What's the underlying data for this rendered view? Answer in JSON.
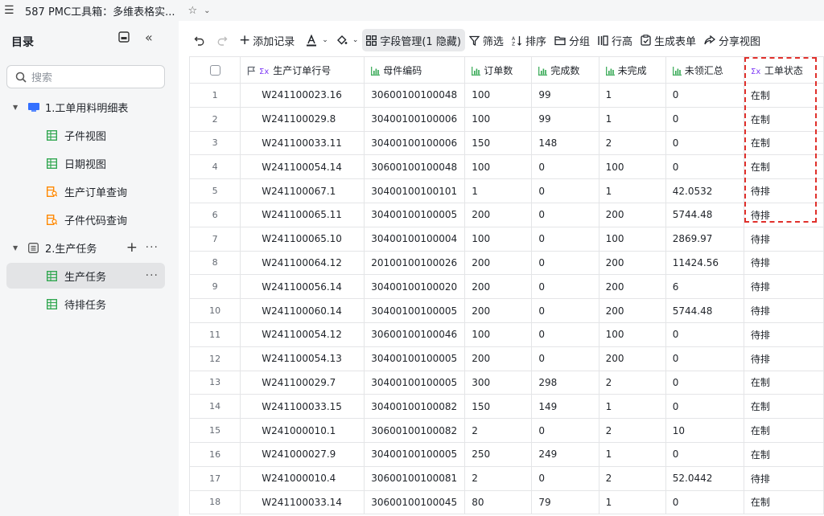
{
  "window": {
    "title": "587 PMC工具箱：多维表格实..."
  },
  "sidebar": {
    "header": "目录",
    "search_placeholder": "搜索",
    "items": [
      {
        "label": "1.工单用料明细表"
      },
      {
        "label": "子件视图"
      },
      {
        "label": "日期视图"
      },
      {
        "label": "生产订单查询"
      },
      {
        "label": "子件代码查询"
      },
      {
        "label": "2.生产任务"
      },
      {
        "label": "生产任务"
      },
      {
        "label": "待排任务"
      }
    ]
  },
  "toolbar": {
    "add_record": "添加记录",
    "field_manage": "字段管理(1 隐藏)",
    "filter": "筛选",
    "sort": "排序",
    "group": "分组",
    "row_height": "行高",
    "gen_form": "生成表单",
    "share_view": "分享视图"
  },
  "table": {
    "columns": [
      "生产订单行号",
      "母件编码",
      "订单数",
      "完成数",
      "未完成",
      "未领汇总",
      "工单状态"
    ],
    "rows": [
      [
        "1",
        "W241100023.16",
        "30600100100048",
        "100",
        "99",
        "1",
        "0",
        "在制"
      ],
      [
        "2",
        "W241100029.8",
        "30400100100006",
        "100",
        "99",
        "1",
        "0",
        "在制"
      ],
      [
        "3",
        "W241100033.11",
        "30400100100006",
        "150",
        "148",
        "2",
        "0",
        "在制"
      ],
      [
        "4",
        "W241100054.14",
        "30600100100048",
        "100",
        "0",
        "100",
        "0",
        "在制"
      ],
      [
        "5",
        "W241100067.1",
        "30400100100101",
        "1",
        "0",
        "1",
        "42.0532",
        "待排"
      ],
      [
        "6",
        "W241100065.11",
        "30400100100005",
        "200",
        "0",
        "200",
        "5744.48",
        "待排"
      ],
      [
        "7",
        "W241100065.10",
        "30400100100004",
        "100",
        "0",
        "100",
        "2869.97",
        "待排"
      ],
      [
        "8",
        "W241100064.12",
        "20100100100026",
        "200",
        "0",
        "200",
        "11424.56",
        "待排"
      ],
      [
        "9",
        "W241100056.14",
        "30400100100020",
        "200",
        "0",
        "200",
        "6",
        "待排"
      ],
      [
        "10",
        "W241100060.14",
        "30400100100005",
        "200",
        "0",
        "200",
        "5744.48",
        "待排"
      ],
      [
        "11",
        "W241100054.12",
        "30600100100046",
        "100",
        "0",
        "100",
        "0",
        "待排"
      ],
      [
        "12",
        "W241100054.13",
        "30400100100005",
        "200",
        "0",
        "200",
        "0",
        "待排"
      ],
      [
        "13",
        "W241100029.7",
        "30400100100005",
        "300",
        "298",
        "2",
        "0",
        "在制"
      ],
      [
        "14",
        "W241100033.15",
        "30400100100082",
        "150",
        "149",
        "1",
        "0",
        "在制"
      ],
      [
        "15",
        "W241000010.1",
        "30600100100082",
        "2",
        "0",
        "2",
        "10",
        "在制"
      ],
      [
        "16",
        "W241000027.9",
        "30400100100005",
        "250",
        "249",
        "1",
        "0",
        "在制"
      ],
      [
        "17",
        "W241000010.4",
        "30600100100081",
        "2",
        "0",
        "2",
        "52.0442",
        "待排"
      ],
      [
        "18",
        "W241100033.14",
        "30600100100045",
        "80",
        "79",
        "1",
        "0",
        "在制"
      ]
    ]
  },
  "colors": {
    "accent": "#3370ff",
    "highlight_border": "#e0302b",
    "formula_icon": "#7f3bf5",
    "sheet_icon": "#34a853",
    "query_icon": "#ff8800"
  }
}
